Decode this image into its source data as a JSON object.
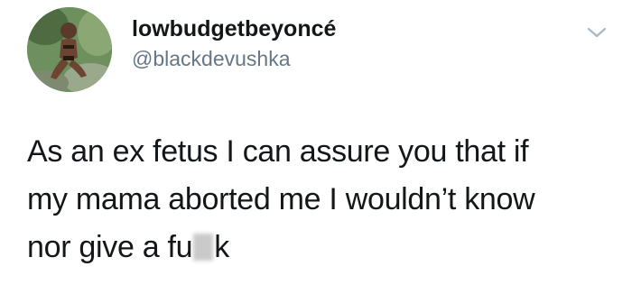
{
  "user": {
    "display_name": "lowbudgetbeyoncé",
    "handle": "@blackdevushka",
    "avatar_icon": "profile-photo"
  },
  "menu": {
    "icon": "chevron-down-icon",
    "color": "#aab8c2"
  },
  "tweet": {
    "lines": [
      "As an ex fetus I can assure you that if",
      "my mama aborted me I wouldn’t know"
    ],
    "last_line_before": "nor give a fu",
    "last_line_after": "k"
  },
  "colors": {
    "text": "#14171a",
    "secondary": "#657786"
  }
}
